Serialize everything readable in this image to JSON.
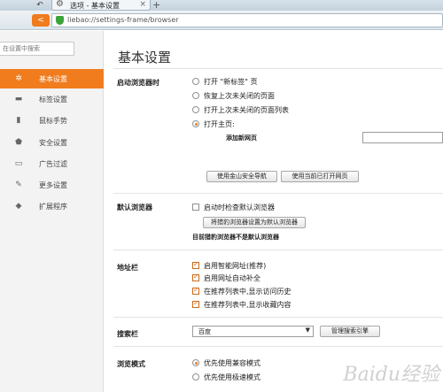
{
  "tab": {
    "title": "选项 - 基本设置",
    "close": "×",
    "new_tab": "+"
  },
  "address_bar": {
    "back": "<",
    "url": "liebao://settings-frame/browser"
  },
  "sidebar": {
    "search_placeholder": "在设置中搜索",
    "items": [
      {
        "label": "基本设置",
        "icon": "gear-icon",
        "glyph": "✲",
        "active": true
      },
      {
        "label": "标签设置",
        "icon": "tab-icon",
        "glyph": "▬",
        "active": false
      },
      {
        "label": "鼠标手势",
        "icon": "mouse-icon",
        "glyph": "▮",
        "active": false
      },
      {
        "label": "安全设置",
        "icon": "shield-icon",
        "glyph": "⬟",
        "active": false
      },
      {
        "label": "广告过滤",
        "icon": "ad-filter-icon",
        "glyph": "▭",
        "active": false
      },
      {
        "label": "更多设置",
        "icon": "wrench-icon",
        "glyph": "✎",
        "active": false
      },
      {
        "label": "扩展程序",
        "icon": "puzzle-icon",
        "glyph": "◆",
        "active": false
      }
    ]
  },
  "main": {
    "title": "基本设置",
    "startup": {
      "label": "启动浏览器时",
      "options": [
        {
          "text": "打开 \"新标签\" 页",
          "checked": false
        },
        {
          "text": "恢复上次未关闭的页面",
          "checked": false
        },
        {
          "text": "打开上次未关闭的页面列表",
          "checked": false
        },
        {
          "text": "打开主页:",
          "checked": true
        }
      ],
      "homepage_label": "添加新网页",
      "homepage_value": "",
      "btn_jinshan_nav": "使用金山安全导航",
      "btn_current_pages": "使用当前已打开网页"
    },
    "default_browser": {
      "label": "默认浏览器",
      "check_startup": "启动时检查默认浏览器",
      "btn_set_default": "将猎豹浏览器设置为默认浏览器",
      "status": "目前猎豹浏览器不是默认浏览器"
    },
    "address_bar": {
      "label": "地址栏",
      "options": [
        {
          "text": "启用智能网址(推荐)",
          "checked": true
        },
        {
          "text": "启用网址自动补全",
          "checked": true
        },
        {
          "text": "在推荐列表中,显示访问历史",
          "checked": true
        },
        {
          "text": "在推荐列表中,显示收藏内容",
          "checked": true
        }
      ]
    },
    "search_bar": {
      "label": "搜索栏",
      "engine": "百度",
      "btn_manage": "管理搜索引擎"
    },
    "browse_mode": {
      "label": "浏览模式",
      "options": [
        {
          "text": "优先使用兼容模式",
          "checked": true
        },
        {
          "text": "优先使用极速模式",
          "checked": false
        }
      ]
    }
  },
  "watermark": "Baidu经验"
}
